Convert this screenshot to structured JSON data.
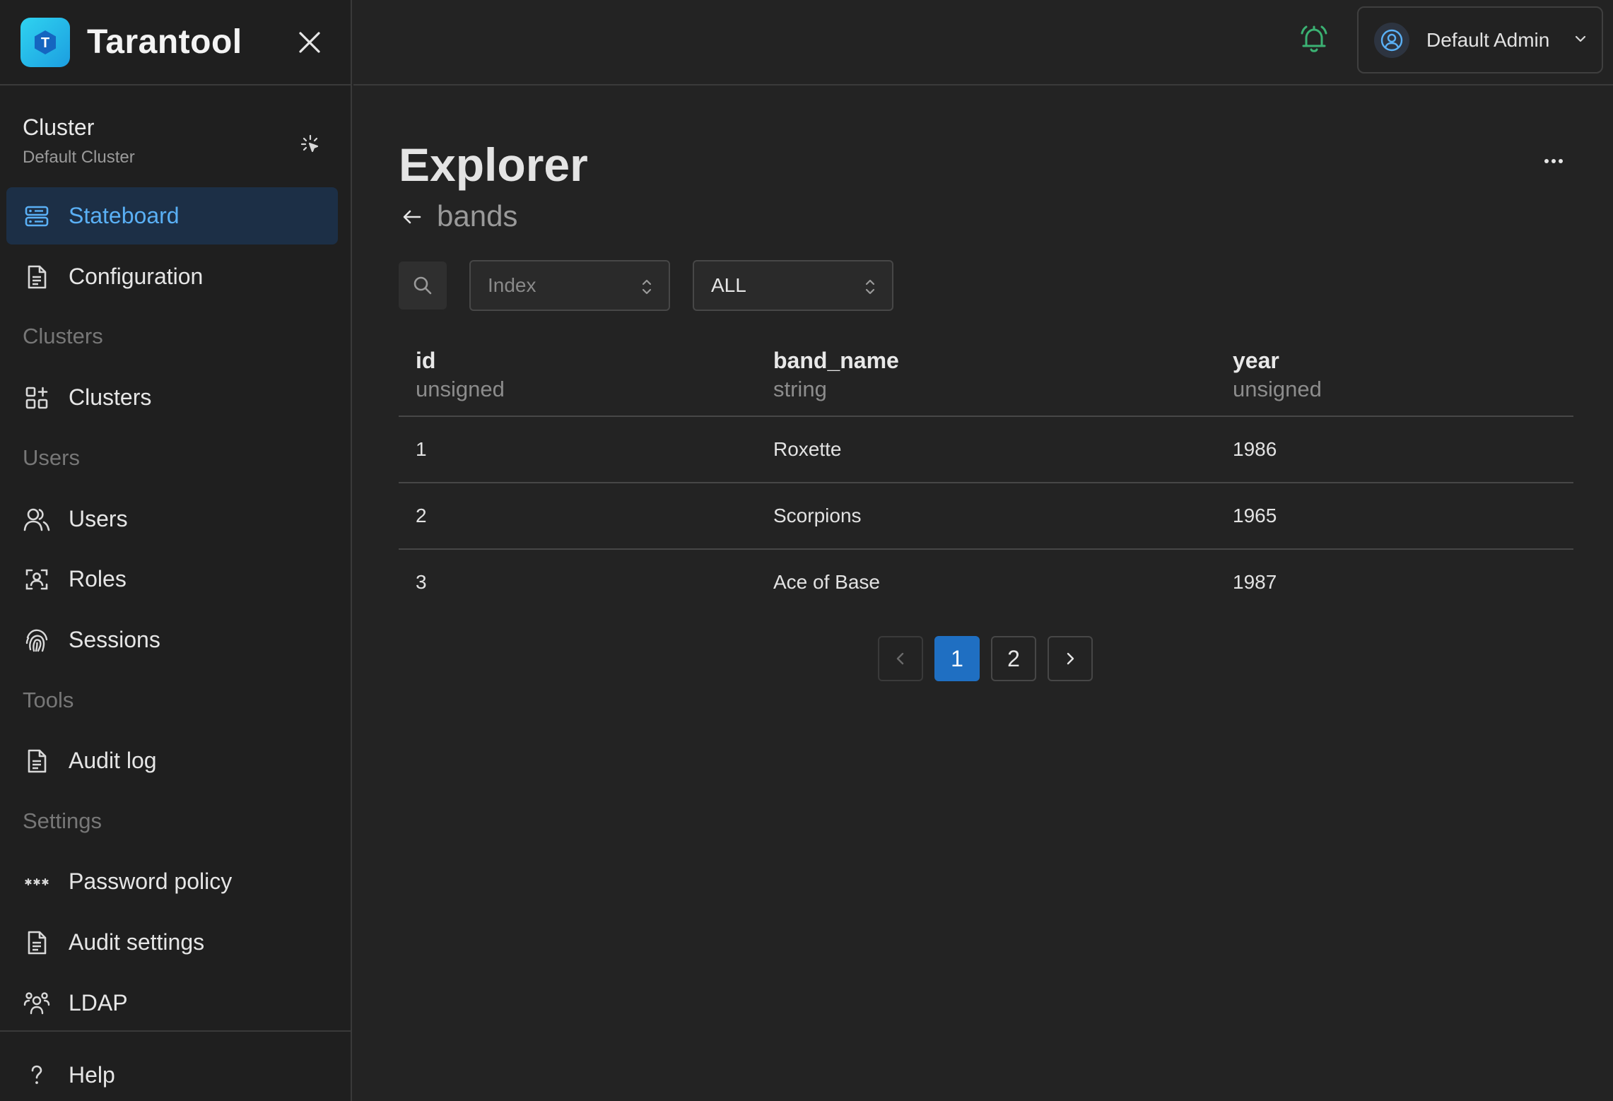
{
  "brand": {
    "name": "Tarantool",
    "logo_letter": "T"
  },
  "cluster": {
    "title": "Cluster",
    "subtitle": "Default Cluster"
  },
  "sidebar": {
    "items": [
      {
        "label": "Stateboard",
        "icon": "server-icon",
        "active": true
      },
      {
        "label": "Configuration",
        "icon": "document-icon"
      },
      {
        "label": "Clusters",
        "icon": "grid-add-icon"
      },
      {
        "label": "Users",
        "icon": "users-icon"
      },
      {
        "label": "Roles",
        "icon": "role-badge-icon"
      },
      {
        "label": "Sessions",
        "icon": "fingerprint-icon"
      },
      {
        "label": "Audit log",
        "icon": "document-icon"
      },
      {
        "label": "Password policy",
        "icon": "password-dots-icon"
      },
      {
        "label": "Audit settings",
        "icon": "document-icon"
      },
      {
        "label": "LDAP",
        "icon": "group-icon"
      },
      {
        "label": "Help",
        "icon": "question-icon"
      }
    ],
    "sections": [
      "Clusters",
      "Users",
      "Tools",
      "Settings"
    ]
  },
  "header": {
    "user_name": "Default Admin",
    "bell_color": "#3bb273"
  },
  "main": {
    "title": "Explorer",
    "space_name": "bands",
    "index_select": {
      "placeholder": "Index"
    },
    "iterator_select": {
      "value": "ALL"
    },
    "columns": [
      {
        "name": "id",
        "type": "unsigned"
      },
      {
        "name": "band_name",
        "type": "string"
      },
      {
        "name": "year",
        "type": "unsigned"
      }
    ],
    "rows": [
      [
        "1",
        "Roxette",
        "1986"
      ],
      [
        "2",
        "Scorpions",
        "1965"
      ],
      [
        "3",
        "Ace of Base",
        "1987"
      ]
    ],
    "pagination": {
      "pages": [
        "1",
        "2"
      ],
      "current": "1"
    }
  },
  "colors": {
    "accent": "#1f6fc2",
    "active_nav_bg": "#1c2f46",
    "active_nav_text": "#5ab0f5"
  }
}
